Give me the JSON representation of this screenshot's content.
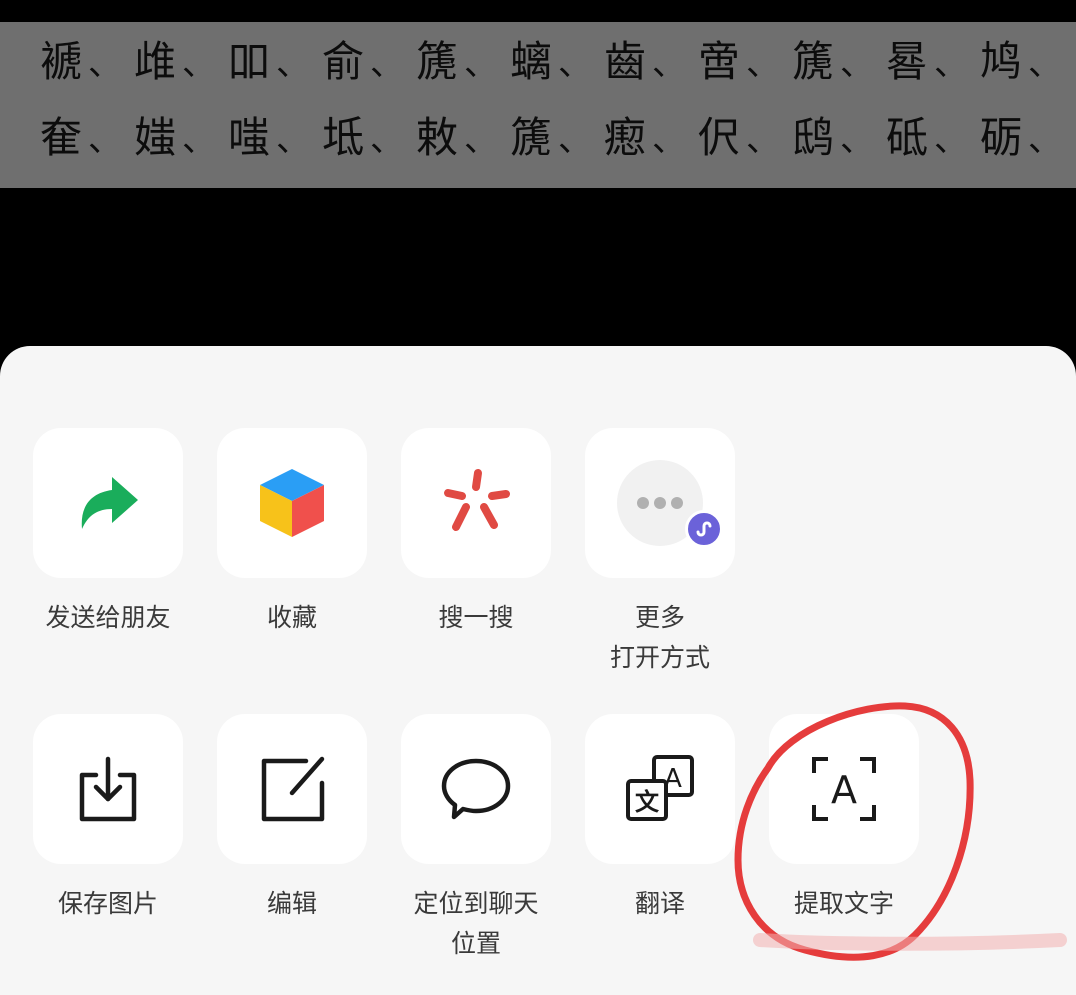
{
  "preview": {
    "row1": [
      "褫",
      "䧳",
      "吅",
      "俞",
      "篪",
      "螭",
      "齒",
      "啻",
      "篪",
      "晷",
      "鸠"
    ],
    "row2": [
      "奞",
      "媸",
      "嗤",
      "坻",
      "敕",
      "篪",
      "瘛",
      "伬",
      "鸱",
      "砥",
      "砺"
    ],
    "separator": "、"
  },
  "sheet": {
    "row1": [
      {
        "label": "发送给朋友",
        "icon": "share-arrow-icon"
      },
      {
        "label": "收藏",
        "icon": "favorite-cube-icon"
      },
      {
        "label": "搜一搜",
        "icon": "search-spark-icon"
      },
      {
        "label": "更多\n打开方式",
        "icon": "more-dots-icon"
      }
    ],
    "row2": [
      {
        "label": "保存图片",
        "icon": "download-icon"
      },
      {
        "label": "编辑",
        "icon": "edit-icon"
      },
      {
        "label": "定位到聊天\n位置",
        "icon": "chat-bubble-icon"
      },
      {
        "label": "翻译",
        "icon": "translate-icon"
      },
      {
        "label": "提取文字",
        "icon": "text-extract-icon"
      }
    ]
  },
  "colors": {
    "share_green": "#1aad5b",
    "cube_blue": "#2a9ef5",
    "cube_yellow": "#f7c21a",
    "cube_red": "#f0504c",
    "search_red": "#e04a43",
    "badge_purple": "#6b62d9",
    "annotation_red": "#e32b2b",
    "sheet_bg": "#f6f6f6",
    "tile_bg": "#ffffff"
  }
}
